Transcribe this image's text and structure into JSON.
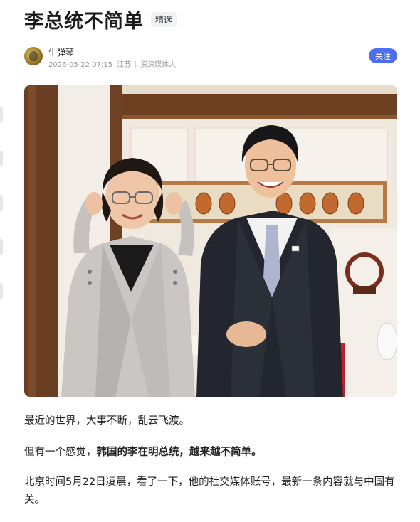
{
  "article": {
    "title": "李总统不简单",
    "tag": "精选"
  },
  "author": {
    "name": "牛弹琴",
    "datetime": "2026-05-22 07:15",
    "location": "江苏",
    "role": "资深媒体人",
    "follow_label": "关注"
  },
  "photo": {
    "icon": "article-photo"
  },
  "paragraphs": {
    "p1": "最近的世界，大事不断，乱云飞渡。",
    "p2_prefix": "但有一个感觉，",
    "p2_bold": "韩国的李在明总统，越来越不简单。",
    "p3": "北京时间5月22日凌晨，看了一下，他的社交媒体账号，最新一条内容就与中国有关。"
  },
  "colors": {
    "accent": "#4e6ef2",
    "meta_text": "#9a9a9a",
    "body_text": "#222222"
  }
}
